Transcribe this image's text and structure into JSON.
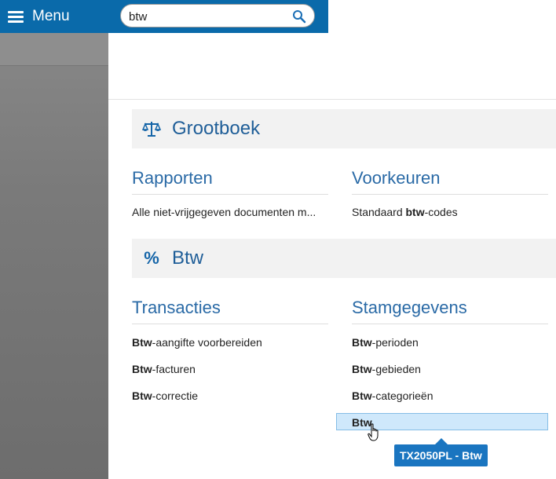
{
  "header": {
    "menu_label": "Menu",
    "search_value": "btw",
    "accent": "#0a6aaa"
  },
  "sections": [
    {
      "title": "Grootboek",
      "icon": "scales-icon",
      "columns": [
        {
          "title": "Rapporten",
          "items": [
            {
              "pre": "Alle niet-vrijgegeven documenten m...",
              "bold": "",
              "post": ""
            }
          ]
        },
        {
          "title": "Voorkeuren",
          "items": [
            {
              "pre": "Standaard ",
              "bold": "btw",
              "post": "-codes"
            }
          ]
        }
      ]
    },
    {
      "title": "Btw",
      "icon": "percent-icon",
      "columns": [
        {
          "title": "Transacties",
          "items": [
            {
              "pre": "",
              "bold": "Btw",
              "post": "-aangifte voorbereiden"
            },
            {
              "pre": "",
              "bold": "Btw",
              "post": "-facturen"
            },
            {
              "pre": "",
              "bold": "Btw",
              "post": "-correctie"
            }
          ]
        },
        {
          "title": "Stamgegevens",
          "items": [
            {
              "pre": "",
              "bold": "Btw",
              "post": "-perioden"
            },
            {
              "pre": "",
              "bold": "Btw",
              "post": "-gebieden"
            },
            {
              "pre": "",
              "bold": "Btw",
              "post": "-categorieën"
            },
            {
              "pre": "",
              "bold": "Btw",
              "post": ""
            }
          ]
        }
      ]
    }
  ],
  "tooltip": "TX2050PL - Btw"
}
